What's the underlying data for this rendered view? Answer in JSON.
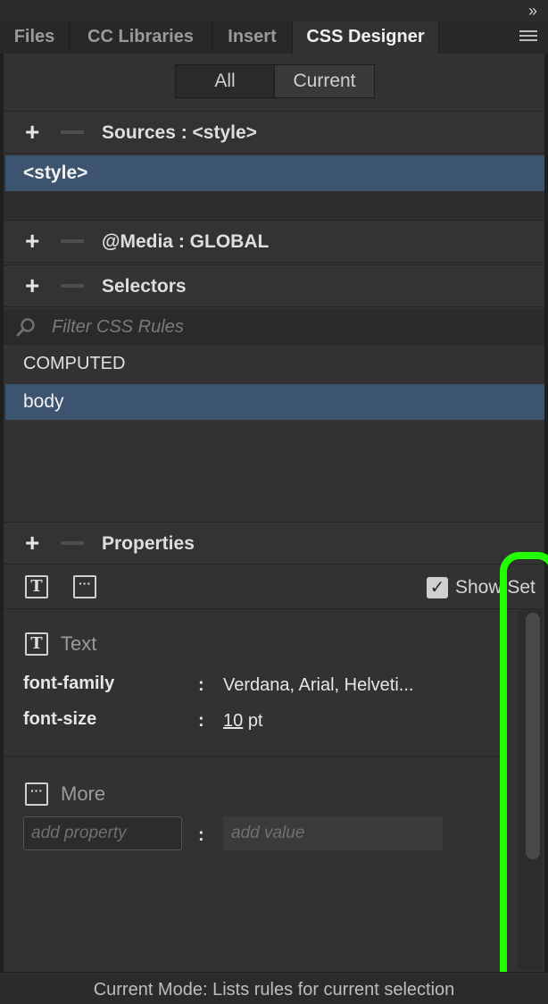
{
  "collapse_icon": "double-chevron-right-icon",
  "tabs": [
    {
      "label": "Files",
      "active": false
    },
    {
      "label": "CC Libraries",
      "active": false
    },
    {
      "label": "Insert",
      "active": false
    },
    {
      "label": "CSS Designer",
      "active": true
    }
  ],
  "panel_menu_icon": "hamburger-menu-icon",
  "mode_toggle": {
    "all_label": "All",
    "current_label": "Current",
    "selected": "Current"
  },
  "sources": {
    "title": "Sources :  <style>",
    "items": [
      "<style>"
    ]
  },
  "media": {
    "title": "@Media :  GLOBAL"
  },
  "selectors": {
    "title": "Selectors",
    "filter_placeholder": "Filter CSS Rules",
    "items": [
      "COMPUTED",
      "body"
    ],
    "selected": "body"
  },
  "properties": {
    "title": "Properties",
    "show_set_label": "Show Set",
    "show_set_checked": true,
    "text_group": {
      "label": "Text",
      "rows": [
        {
          "name": "font-family",
          "value": "Verdana, Arial, Helveti..."
        },
        {
          "name": "font-size",
          "value": "10",
          "unit": "pt"
        }
      ]
    },
    "more_group": {
      "label": "More",
      "add_property_placeholder": "add property",
      "add_value_placeholder": "add value"
    }
  },
  "status": "Current Mode: Lists rules for current selection",
  "colors": {
    "selection": "#3d5470",
    "highlight": "#22ff00",
    "panel_bg": "#323232"
  }
}
